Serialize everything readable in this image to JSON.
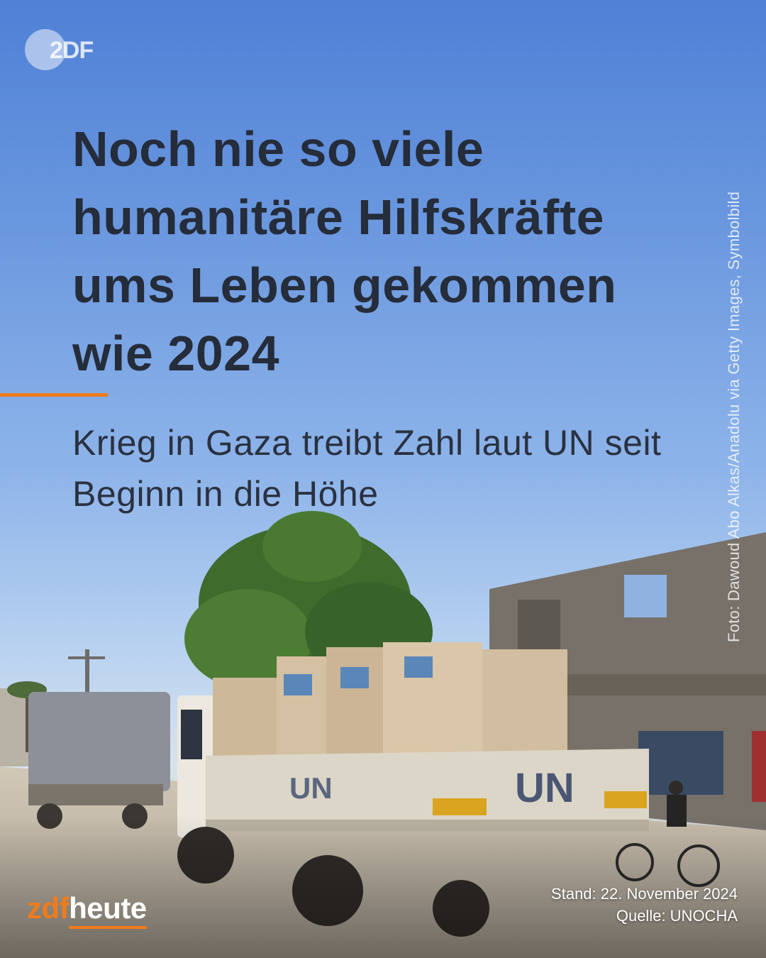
{
  "brand_logo": {
    "text": "2DF",
    "icon": "zdf-logo-icon"
  },
  "headline": "Noch nie so viele humanitäre Hilfskräfte ums Leben gekommen wie 2024",
  "subline": "Krieg in Gaza treibt Zahl laut UN seit Beginn in die Höhe",
  "photo_credit": "Foto: Dawoud Abo Alkas/Anadolu via Getty Images, Symbolbild",
  "photo": {
    "truck_marking": "UN"
  },
  "meta": {
    "date": "Stand: 22. November 2024",
    "source": "Quelle: UNOCHA"
  },
  "footer_brand": {
    "part1": "zdf",
    "part2": "heute"
  },
  "colors": {
    "accent": "#f07b1d",
    "text": "#252c3a",
    "sky": "#5b8ad8"
  }
}
